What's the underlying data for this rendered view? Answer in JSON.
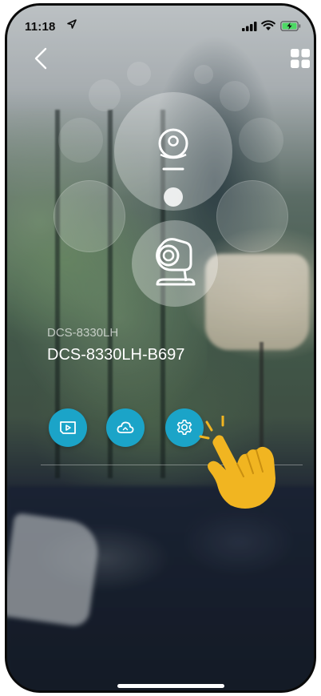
{
  "status_bar": {
    "time": "11:18",
    "icons": [
      "location-arrow-icon",
      "signal-icon",
      "wifi-icon",
      "battery-charging-icon"
    ],
    "battery_color": "#4cd964"
  },
  "nav": {
    "back_icon": "chevron-left-icon",
    "menu_icon": "grid-icon"
  },
  "device": {
    "model": "DCS-8330LH",
    "name": "DCS-8330LH-B697",
    "icons": [
      "camera-dome-icon",
      "camera-main-icon"
    ]
  },
  "actions": [
    {
      "icon": "playback-icon",
      "color": "#1ba4c8"
    },
    {
      "icon": "cloud-icon",
      "color": "#1ba4c8"
    },
    {
      "icon": "settings-gear-icon",
      "color": "#1ba4c8"
    }
  ],
  "hint": {
    "icon": "tap-hand-icon",
    "color": "#f1b521"
  }
}
